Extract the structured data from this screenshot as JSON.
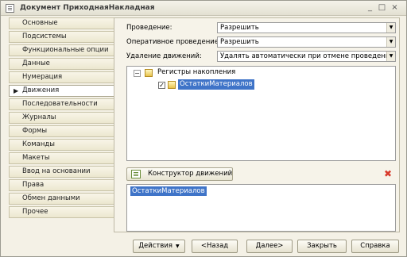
{
  "window": {
    "title": "Документ ПриходнаяНакладная",
    "minimize": "_",
    "maximize": "□",
    "close": "×"
  },
  "tabs": [
    {
      "label": "Основные",
      "active": false
    },
    {
      "label": "Подсистемы",
      "active": false
    },
    {
      "label": "Функциональные опции",
      "active": false
    },
    {
      "label": "Данные",
      "active": false
    },
    {
      "label": "Нумерация",
      "active": false
    },
    {
      "label": "Движения",
      "active": true
    },
    {
      "label": "Последовательности",
      "active": false
    },
    {
      "label": "Журналы",
      "active": false
    },
    {
      "label": "Формы",
      "active": false
    },
    {
      "label": "Команды",
      "active": false
    },
    {
      "label": "Макеты",
      "active": false
    },
    {
      "label": "Ввод на основании",
      "active": false
    },
    {
      "label": "Права",
      "active": false
    },
    {
      "label": "Обмен данными",
      "active": false
    },
    {
      "label": "Прочее",
      "active": false
    }
  ],
  "active_marker": "▶",
  "form": {
    "posting_label": "Проведение:",
    "posting_value": "Разрешить",
    "realtime_posting_label": "Оперативное проведение:",
    "realtime_posting_value": "Разрешить",
    "delete_movements_label": "Удаление движений:",
    "delete_movements_value": "Удалять автоматически при отмене проведения"
  },
  "tree": {
    "root_label": "Регистры накопления",
    "root_expanded": "−",
    "child_label": "ОстаткиМатериалов",
    "child_checked": "✓"
  },
  "constructor_button": "Конструктор движений",
  "delete_icon": "✖",
  "selected_registers": "ОстаткиМатериалов",
  "buttons": {
    "actions": "Действия",
    "dropdown": "▼",
    "back": "<Назад",
    "next": "Далее>",
    "close": "Закрыть",
    "help": "Справка"
  }
}
